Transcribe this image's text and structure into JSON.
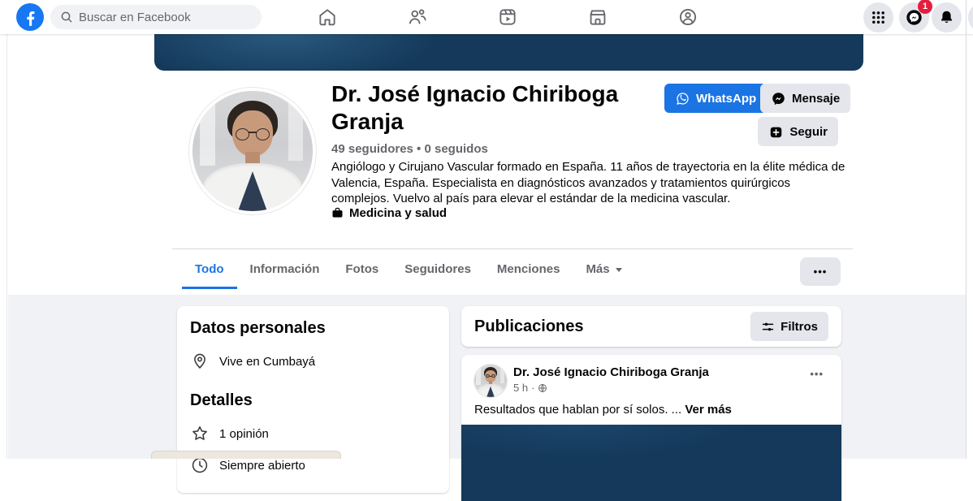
{
  "nav": {
    "search_placeholder": "Buscar en Facebook",
    "messenger_badge": "1",
    "icons": [
      "facebook-logo",
      "search-icon",
      "home-icon",
      "friends-icon",
      "reels-icon",
      "marketplace-icon",
      "groups-icon",
      "menu-grid-icon",
      "messenger-icon",
      "bell-icon"
    ]
  },
  "profile": {
    "name": "Dr. José Ignacio Chiriboga Granja",
    "followers_line": "49 seguidores • 0 seguidos",
    "bio": "Angiólogo y Cirujano Vascular formado en España. 11 años de trayectoria en la élite médica de Valencia, España. Especialista en diagnósticos avanzados y tratamientos quirúrgicos complejos. Vuelvo al país para elevar el estándar de la medicina vascular.",
    "category": "Medicina y salud",
    "actions": {
      "whatsapp": "WhatsApp",
      "message": "Mensaje",
      "follow": "Seguir"
    }
  },
  "tabs": {
    "items": [
      "Todo",
      "Información",
      "Fotos",
      "Seguidores",
      "Menciones"
    ],
    "active": "Todo",
    "more_label": "Más",
    "overflow_label": "•••"
  },
  "sidebar": {
    "intro_title": "Datos personales",
    "lives_in": "Vive en Cumbayá",
    "details_title": "Detalles",
    "review": "1 opinión",
    "hours": "Siempre abierto"
  },
  "posts": {
    "title": "Publicaciones",
    "filters_label": "Filtros",
    "post": {
      "author": "Dr. José Ignacio Chiriboga Granja",
      "time": "5 h",
      "dot": "·",
      "text": "Resultados que hablan por sí solos. ...",
      "see_more": "Ver más",
      "menu_label": "•••"
    }
  },
  "colors": {
    "facebook_blue": "#1877f2",
    "button_blue": "#1b74e4",
    "cover_navy": "#14395a",
    "background_gray": "#f0f2f5",
    "badge_red": "#e41e3f",
    "muted_text": "#65676b"
  }
}
